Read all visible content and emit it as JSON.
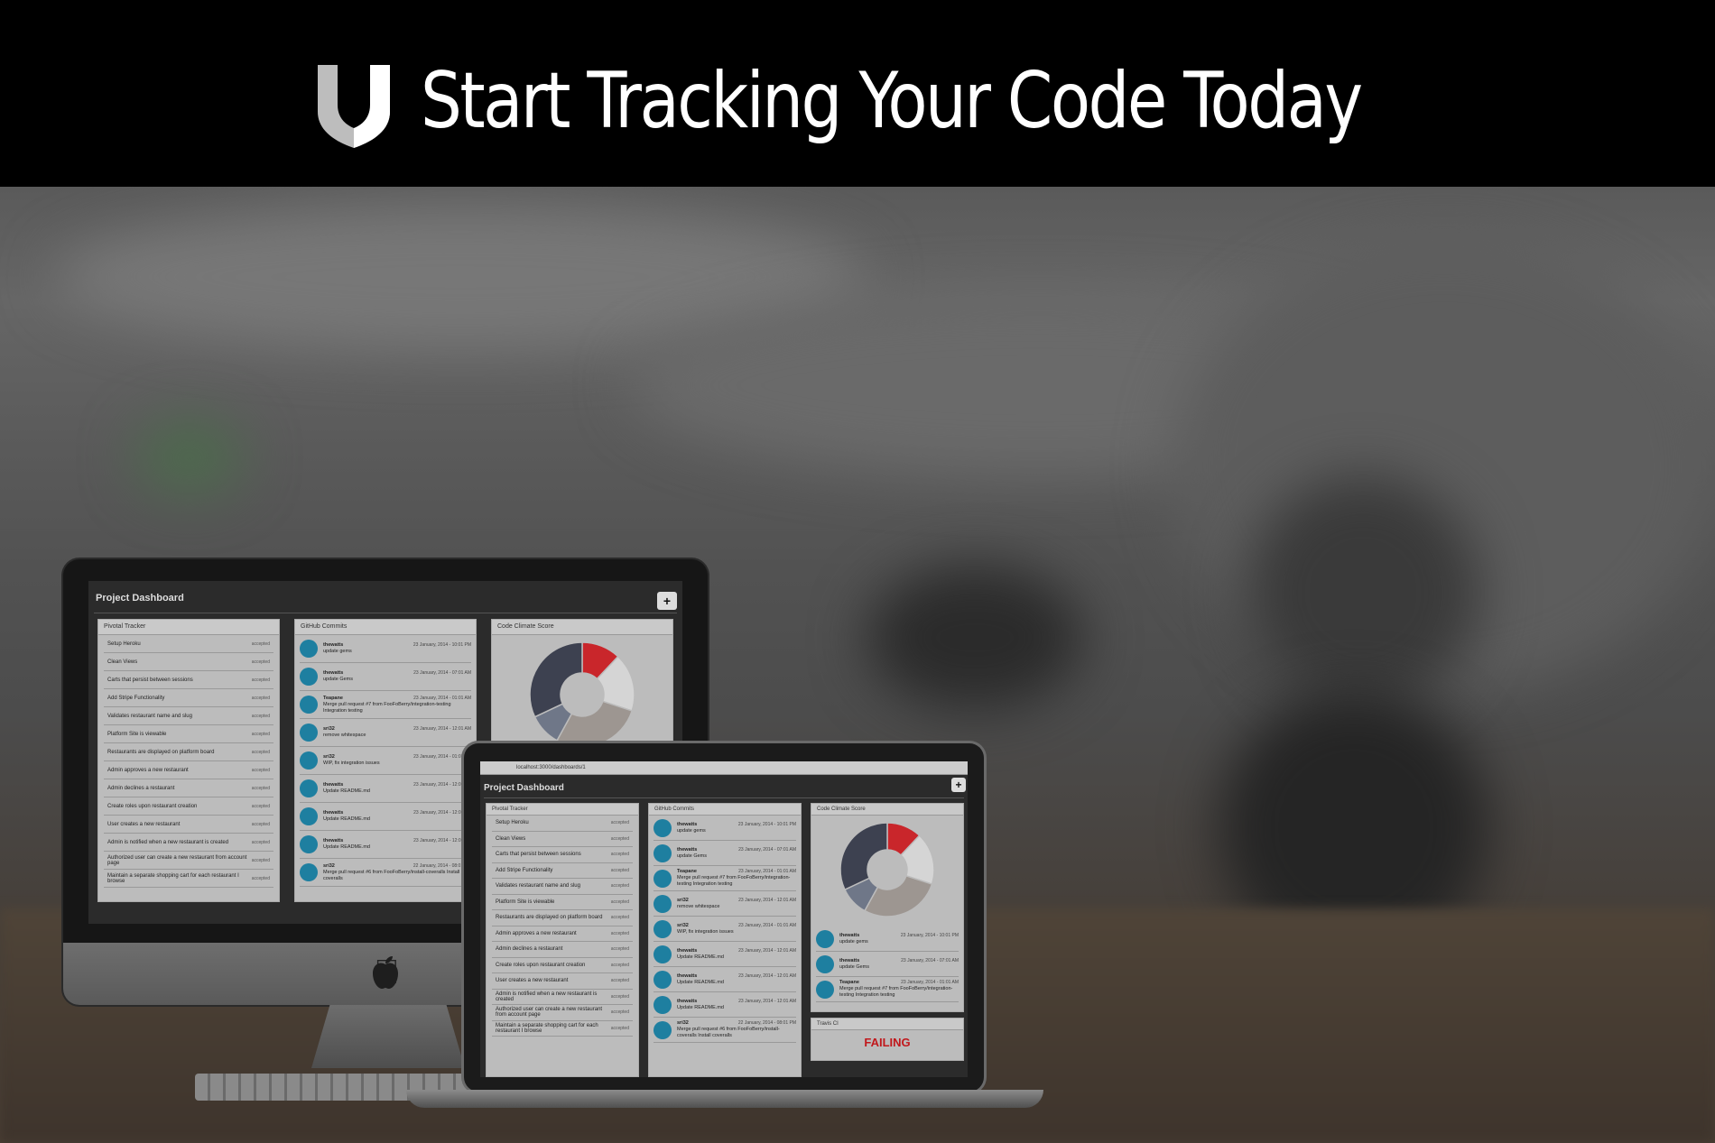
{
  "header": {
    "title": "Start Tracking Your Code Today",
    "logo_icon": "shield-icon"
  },
  "dashboard": {
    "title": "Project Dashboard",
    "add_label": "+",
    "browser_url": "localhost:3000/dashboards/1",
    "pivotal": {
      "title": "Pivotal Tracker",
      "stories": [
        {
          "label": "Setup Heroku",
          "status": "accepted"
        },
        {
          "label": "Clean Views",
          "status": "accepted"
        },
        {
          "label": "Carts that persist between sessions",
          "status": "accepted"
        },
        {
          "label": "Add Stripe Functionality",
          "status": "accepted"
        },
        {
          "label": "Validates restaurant name and slug",
          "status": "accepted"
        },
        {
          "label": "Platform Site is viewable",
          "status": "accepted"
        },
        {
          "label": "Restaurants are displayed on platform board",
          "status": "accepted"
        },
        {
          "label": "Admin approves a new restaurant",
          "status": "accepted"
        },
        {
          "label": "Admin declines a restaurant",
          "status": "accepted"
        },
        {
          "label": "Create roles upon restaurant creation",
          "status": "accepted"
        },
        {
          "label": "User creates a new restaurant",
          "status": "accepted"
        },
        {
          "label": "Admin is notified when a new restaurant is created",
          "status": "accepted"
        },
        {
          "label": "Authorized user can create a new restaurant from account page",
          "status": "accepted"
        },
        {
          "label": "Maintain a separate shopping cart for each restaurant I browse",
          "status": "accepted"
        }
      ]
    },
    "github": {
      "title": "GitHub Commits",
      "commits": [
        {
          "user": "thewatts",
          "message": "update gems",
          "time": "23 January, 2014 - 10:01 PM"
        },
        {
          "user": "thewatts",
          "message": "update Gems",
          "time": "23 January, 2014 - 07:01 AM"
        },
        {
          "user": "Teapane",
          "message": "Merge pull request #7 from FooFoBerry/integration-testing Integration testing",
          "time": "23 January, 2014 - 01:01 AM"
        },
        {
          "user": "sri32",
          "message": "remove whitespace",
          "time": "23 January, 2014 - 12:01 AM"
        },
        {
          "user": "sri32",
          "message": "WIP, fix integration issues",
          "time": "23 January, 2014 - 01:01 AM"
        },
        {
          "user": "thewatts",
          "message": "Update README.md",
          "time": "23 January, 2014 - 12:01 AM"
        },
        {
          "user": "thewatts",
          "message": "Update README.md",
          "time": "23 January, 2014 - 12:01 AM"
        },
        {
          "user": "thewatts",
          "message": "Update README.md",
          "time": "23 January, 2014 - 12:01 AM"
        },
        {
          "user": "sri32",
          "message": "Merge pull request #6 from FooFoBerry/install-coveralls Install coveralls",
          "time": "22 January, 2014 - 08:01 PM"
        }
      ]
    },
    "codeclimate": {
      "title": "Code Climate Score",
      "donut": [
        {
          "value": 12,
          "color": "#c9262b"
        },
        {
          "value": 18,
          "color": "#d5d5d5"
        },
        {
          "value": 28,
          "color": "#9d9691"
        },
        {
          "value": 10,
          "color": "#6f7788"
        },
        {
          "value": 32,
          "color": "#3d4150"
        }
      ],
      "center_color": "#c9c9c9"
    },
    "travis": {
      "title": "Travis CI",
      "status": "FAILING",
      "status_color": "#c1181c"
    }
  }
}
